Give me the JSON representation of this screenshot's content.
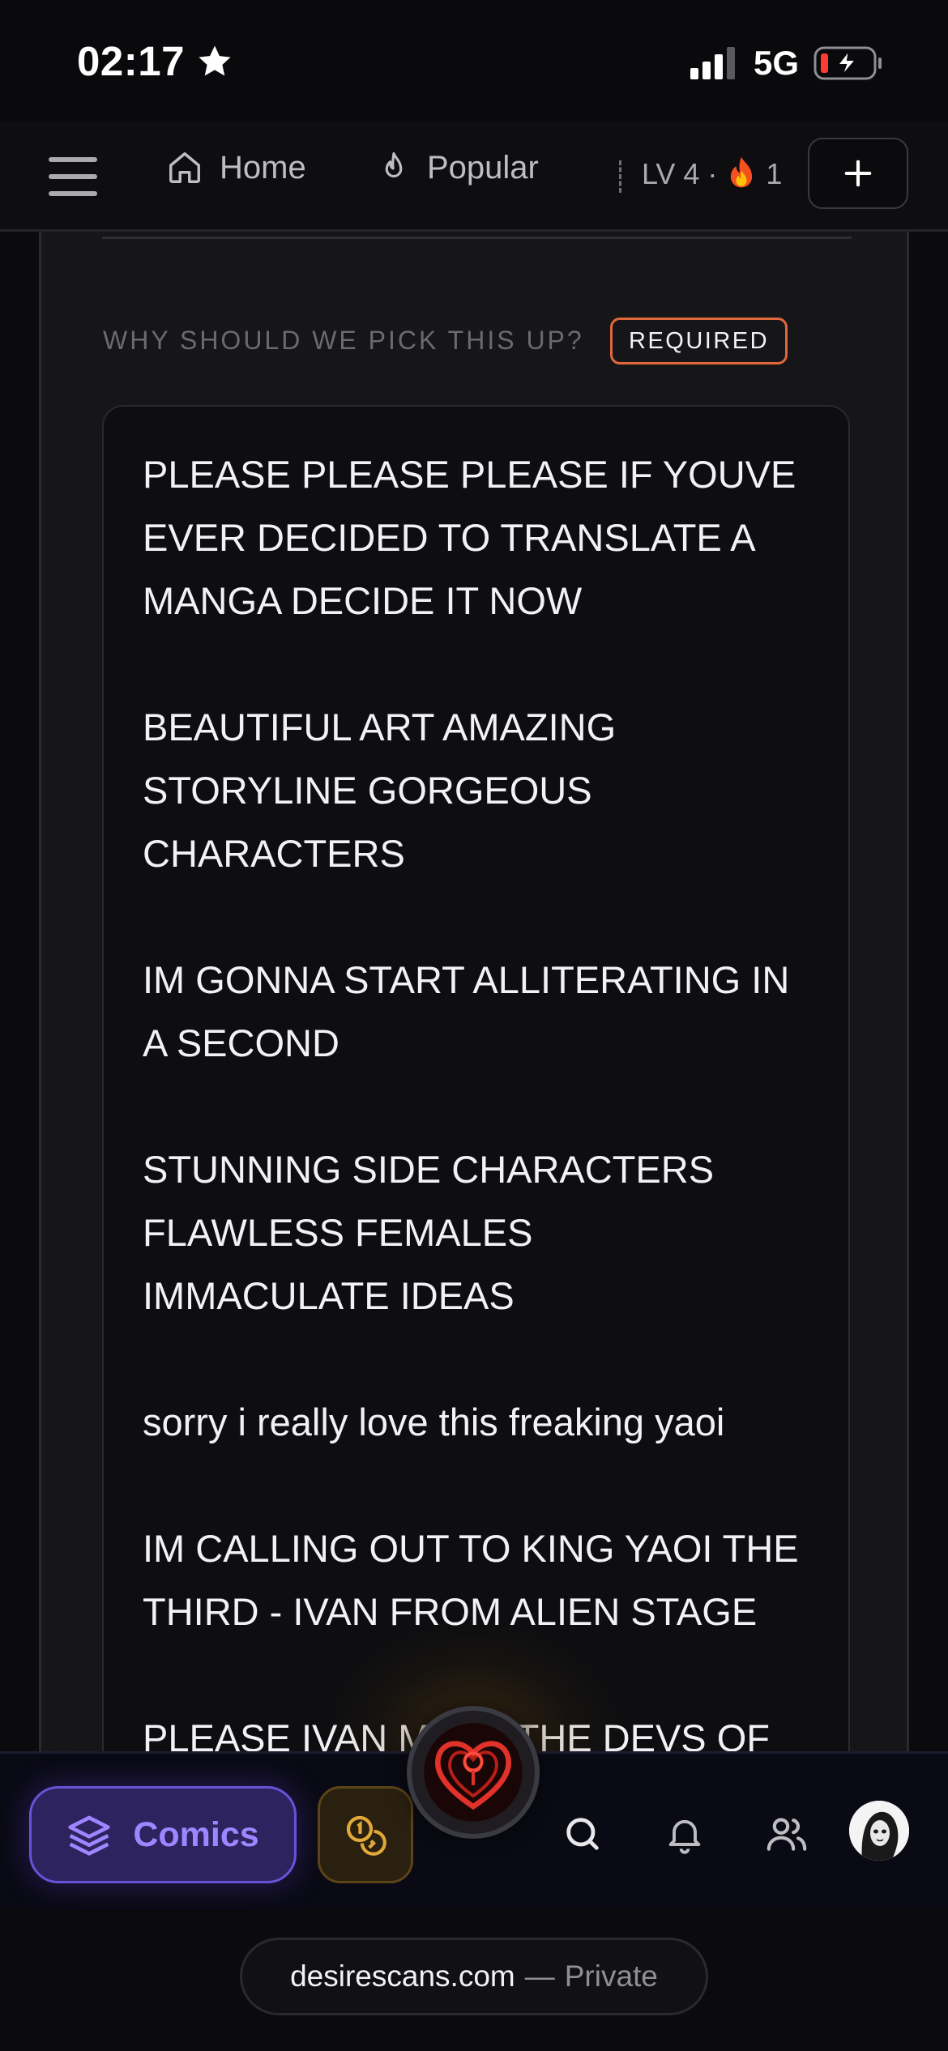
{
  "status_bar": {
    "time": "02:17",
    "network": "5G"
  },
  "nav": {
    "home_label": "Home",
    "popular_label": "Popular",
    "level_text": "LV 4 ·",
    "streak_count": "1",
    "add_label": "+"
  },
  "form": {
    "label": "WHY SHOULD WE PICK THIS UP?",
    "required_badge": "REQUIRED",
    "reason_value": "PLEASE PLEASE PLEASE IF YOUVE\nEVER DECIDED TO TRANSLATE A\nMANGA DECIDE IT NOW\n\nBEAUTIFUL ART AMAZING\nSTORYLINE GORGEOUS\nCHARACTERS\n\nIM GONNA START ALLITERATING IN\nA SECOND\n\nSTUNNING SIDE CHARACTERS\nFLAWLESS FEMALES\nIMMACULATE IDEAS\n\nsorry i really love this freaking yaoi\n\nIM CALLING OUT TO KING YAOI THE\nTHIRD - IVAN FROM ALIEN STAGE\n\nPLEASE IVAN MAKE THE DEVS OF"
  },
  "bottom_nav": {
    "comics_label": "Comics",
    "icons": [
      "layers-icon",
      "coins-icon",
      "heart-logo-icon",
      "search-icon",
      "bell-icon",
      "users-icon",
      "avatar"
    ]
  },
  "browser": {
    "domain": "desirescans.com",
    "separator": "—",
    "mode": "Private"
  },
  "colors": {
    "accent_required": "#e0683c",
    "comics_purple": "#9d86ff",
    "coins_gold": "#e0a93a",
    "logo_red": "#e0322a"
  }
}
